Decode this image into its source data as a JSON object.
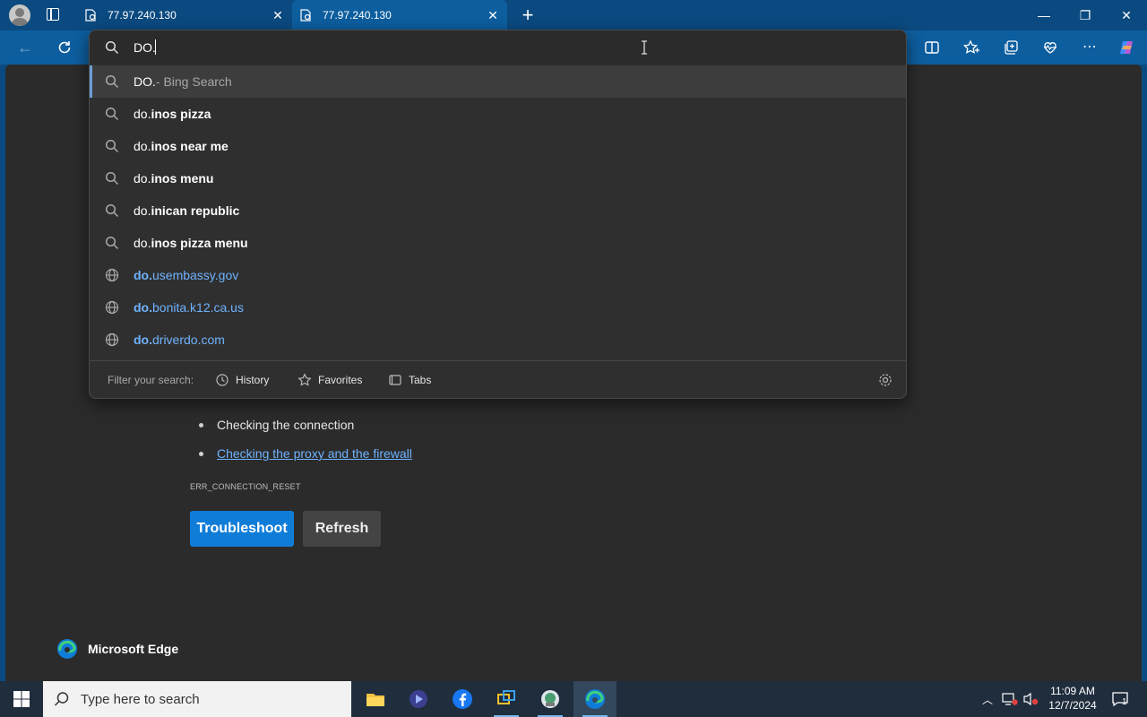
{
  "browser": {
    "tabs": [
      {
        "title": "77.97.240.130",
        "close": "✕"
      },
      {
        "title": "77.97.240.130",
        "close": "✕"
      }
    ],
    "new_tab": "+",
    "window_controls": {
      "minimize": "—",
      "restore": "❐",
      "close": "✕"
    }
  },
  "omnibox": {
    "value": "DO.",
    "suggestions": [
      {
        "kind": "search",
        "typed": "DO.",
        "rest": "",
        "sub": " - Bing Search",
        "highlighted": true
      },
      {
        "kind": "search",
        "typed": "do.",
        "rest": "inos pizza"
      },
      {
        "kind": "search",
        "typed": "do.",
        "rest": "inos near me"
      },
      {
        "kind": "search",
        "typed": "do.",
        "rest": "inos menu"
      },
      {
        "kind": "search",
        "typed": "do.",
        "rest": "inican republic"
      },
      {
        "kind": "search",
        "typed": "do.",
        "rest": "inos pizza menu"
      },
      {
        "kind": "url",
        "typed": "do.",
        "rest": "usembassy.gov"
      },
      {
        "kind": "url",
        "typed": "do.",
        "rest": "bonita.k12.ca.us"
      },
      {
        "kind": "url",
        "typed": "do.",
        "rest": "driverdo.com"
      }
    ],
    "filter": {
      "label": "Filter your search:",
      "history": "History",
      "favorites": "Favorites",
      "tabs": "Tabs"
    }
  },
  "error_page": {
    "items": [
      "Checking the connection",
      "Checking the proxy and the firewall"
    ],
    "error_code": "ERR_CONNECTION_RESET",
    "troubleshoot": "Troubleshoot",
    "refresh": "Refresh",
    "brand": "Microsoft Edge"
  },
  "taskbar": {
    "search_placeholder": "Type here to search",
    "time": "11:09 AM",
    "date": "12/7/2024",
    "notification_count": "1"
  },
  "colors": {
    "accent": "#0f7dd8",
    "link": "#6fb3ff",
    "titlebar": "#0b4a80"
  }
}
